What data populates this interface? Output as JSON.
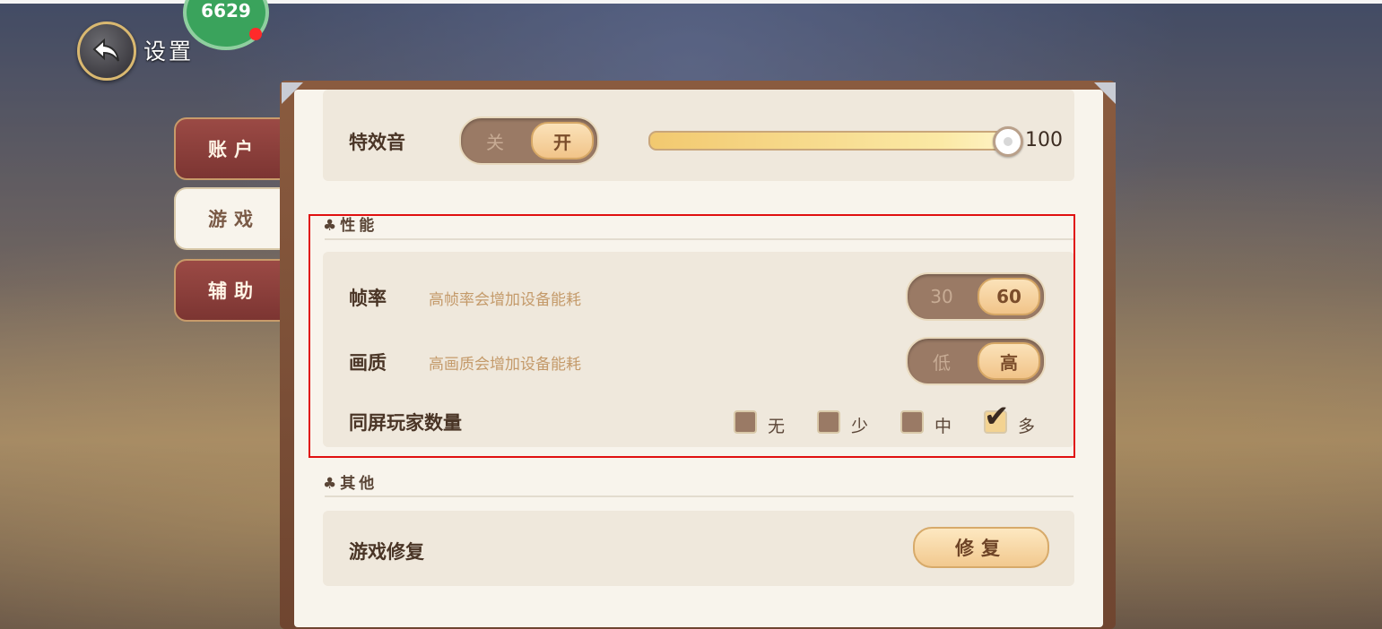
{
  "header": {
    "title": "设置",
    "back_icon": "back-arrow-icon",
    "avatar_text": "6629"
  },
  "tabs": [
    {
      "label": "账户",
      "active": false
    },
    {
      "label": "游戏",
      "active": true
    },
    {
      "label": "辅助",
      "active": false
    }
  ],
  "audio": {
    "effects_label": "特效音",
    "toggle_off": "关",
    "toggle_on": "开",
    "volume": "100"
  },
  "performance": {
    "section_title": "性能",
    "framerate": {
      "label": "帧率",
      "hint": "高帧率会增加设备能耗",
      "opt_low": "30",
      "opt_high": "60",
      "selected": "60"
    },
    "quality": {
      "label": "画质",
      "hint": "高画质会增加设备能耗",
      "opt_low": "低",
      "opt_high": "高",
      "selected": "高"
    },
    "players": {
      "label": "同屏玩家数量",
      "options": [
        {
          "label": "无",
          "checked": false
        },
        {
          "label": "少",
          "checked": false
        },
        {
          "label": "中",
          "checked": false
        },
        {
          "label": "多",
          "checked": true
        }
      ]
    }
  },
  "other": {
    "section_title": "其他",
    "repair_label": "游戏修复",
    "repair_button": "修复"
  },
  "colors": {
    "highlight": "#e01010",
    "tab_inactive": "#8b3f3b",
    "panel": "#f8f4ec"
  }
}
